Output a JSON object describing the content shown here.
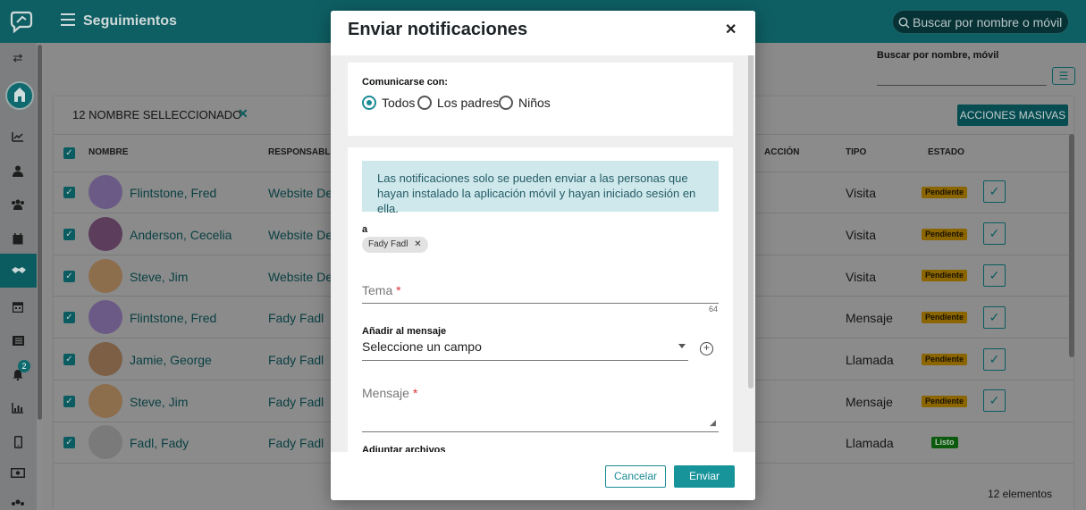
{
  "header": {
    "title": "Seguimientos",
    "search_placeholder": "Buscar por nombre o móvil"
  },
  "sidebar": {
    "notification_badge": "2",
    "icons": [
      "swap-icon",
      "church-icon",
      "chart-line-icon",
      "user-icon",
      "group-icon",
      "calendar-icon",
      "handshake-icon",
      "calendar-grid-icon",
      "list-icon",
      "bell-icon",
      "bar-chart-icon",
      "mobile-icon",
      "money-icon",
      "people-group-icon"
    ]
  },
  "page": {
    "search_label": "Buscar por nombre, móvil",
    "selected_label": "12 NOMBRE SELLECCIONADO",
    "bulk_actions_label": "ACCIONES MASIVAS",
    "columns": [
      "NOMBRE",
      "RESPONSABLE",
      "ACCIÓN",
      "TIPO",
      "ESTADO"
    ],
    "rows": [
      {
        "name": "Flintstone, Fred",
        "responsible": "Website Der",
        "type": "Visita",
        "status": "Pendiente"
      },
      {
        "name": "Anderson, Cecelia",
        "responsible": "Website Der",
        "type": "Visita",
        "status": "Pendiente"
      },
      {
        "name": "Steve, Jim",
        "responsible": "Website Der",
        "type": "Visita",
        "status": "Pendiente"
      },
      {
        "name": "Flintstone, Fred",
        "responsible": "Fady Fadl",
        "type": "Mensaje",
        "status": "Pendiente"
      },
      {
        "name": "Jamie, George",
        "responsible": "Fady Fadl",
        "type": "Llamada",
        "status": "Pendiente"
      },
      {
        "name": "Steve, Jim",
        "responsible": "Fady Fadl",
        "type": "Mensaje",
        "status": "Pendiente"
      },
      {
        "name": "Fadl, Fady",
        "responsible": "Fady Fadl",
        "type": "Llamada",
        "status": "Listo"
      }
    ],
    "footer_count": "12 elementos"
  },
  "modal": {
    "title": "Enviar notificaciones",
    "communicate_label": "Comunicarse con:",
    "radio_options": [
      "Todos",
      "Los padres",
      "Niños"
    ],
    "selected_radio": "Todos",
    "info_text": "Las notificaciones solo se pueden enviar a las personas que hayan instalado la aplicación móvil y hayan iniciado sesión en ella.",
    "to_label": "a",
    "recipient_chip": "Fady Fadl",
    "subject_label": "Tema",
    "subject_counter": "64",
    "add_to_message_label": "Añadir al mensaje",
    "select_field_value": "Seleccione un campo",
    "message_label": "Mensaje",
    "attachments_label": "Adjuntar archivos",
    "cancel_label": "Cancelar",
    "send_label": "Enviar"
  }
}
